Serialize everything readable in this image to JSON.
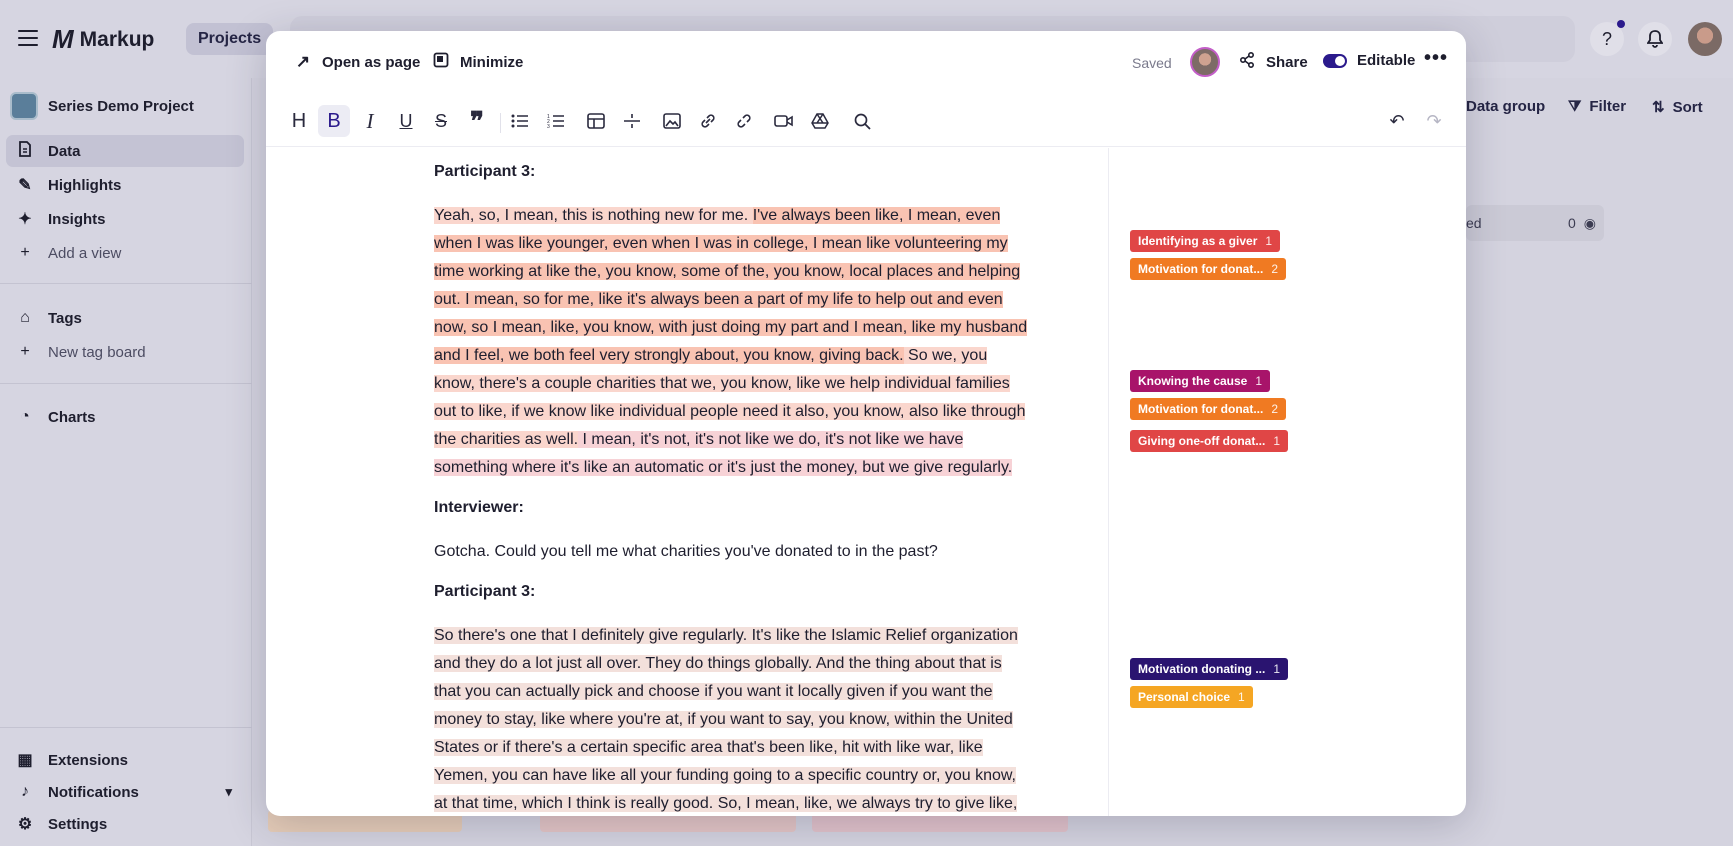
{
  "app": {
    "name": "Markup",
    "projects_label": "Projects"
  },
  "sidebar": {
    "project_name": "Series Demo Project",
    "views": [
      {
        "label": "Data",
        "icon": "document-icon",
        "active": true
      },
      {
        "label": "Highlights",
        "icon": "highlighter-icon"
      },
      {
        "label": "Insights",
        "icon": "sparkle-icon"
      },
      {
        "label": "Add a view",
        "icon": "plus-icon"
      }
    ],
    "tags_label": "Tags",
    "new_tag_board_label": "New tag board",
    "charts_label": "Charts",
    "extensions_label": "Extensions",
    "notifications_label": "Notifications",
    "settings_label": "Settings"
  },
  "background_toolbar": {
    "data_group_label": "Data group",
    "filter_label": "Filter",
    "sort_label": "Sort",
    "card_label": "ed",
    "card_count": "0"
  },
  "modal": {
    "open_as_page_label": "Open as page",
    "minimize_label": "Minimize",
    "saved_label": "Saved",
    "share_label": "Share",
    "editable_label": "Editable",
    "toolbar_icons": [
      "heading-icon",
      "bold-icon",
      "italic-icon",
      "underline-icon",
      "strikethrough-icon",
      "quote-icon",
      "bullet-list-icon",
      "numbered-list-icon",
      "table-icon",
      "divider-icon",
      "image-icon",
      "link-icon",
      "unlink-icon",
      "video-icon",
      "drive-icon",
      "search-replace-icon",
      "undo-icon",
      "redo-icon"
    ]
  },
  "transcript": {
    "block1": {
      "speaker": "Participant 3:",
      "seg1": "Yeah, so, I mean, this is nothing new for me. ",
      "seg2": "I've always been like, I mean, even when I was like younger, even when I was in college, I mean like volunteering my time working at like the, you know, some of the, you know, local places and helping out. I mean, so for me, like it's always been a part of my life to help out and even now, so I mean, like, you know, with just doing my part and I mean, like my husband and I feel, we both feel very strongly about, you know, giving back.",
      "seg3": " So we, you know, there's a couple charities that we, you know, like we help individual families out to like, if we know like individual people need it also, you know, also like through the charities as well.",
      "seg4": " I mean, it's not, it's not like we do, it's not like we have something where it's like an automatic or it's just the money, but we give regularly."
    },
    "block2": {
      "speaker": "Interviewer:",
      "text": "Gotcha. Could you tell me what charities you've donated to in the past?"
    },
    "block3": {
      "speaker": "Participant 3:",
      "seg1": "So there's one that I definitely give regularly. It's like the Islamic Relief organization and they do a lot just all over. They do things globally. And the thing about that is that you can actually pick and choose if you want it locally given if you want the money to stay, like where you're at, if you want to say, you know, within the United States or if there's a certain specific area that's been like, hit with like war, like Yemen, you can have like all your funding going to a specific country or, you know, at that time, which I think is really good.",
      "seg2": " So, I mean, like, we always try to give like, wherever we, there might be a need at"
    }
  },
  "tags": [
    {
      "label": "Identifying as a giver",
      "count": "1",
      "color": "#e04646"
    },
    {
      "label": "Motivation for donat...",
      "count": "2",
      "color": "#f07a22"
    },
    {
      "label": "Knowing the cause",
      "count": "1",
      "color": "#a8146a"
    },
    {
      "label": "Motivation for donat...",
      "count": "2",
      "color": "#f07a22"
    },
    {
      "label": "Giving one-off donat...",
      "count": "1",
      "color": "#e04646"
    },
    {
      "label": "Motivation donating ...",
      "count": "1",
      "color": "#2a1470"
    },
    {
      "label": "Personal choice",
      "count": "1",
      "color": "#f5a623"
    }
  ]
}
